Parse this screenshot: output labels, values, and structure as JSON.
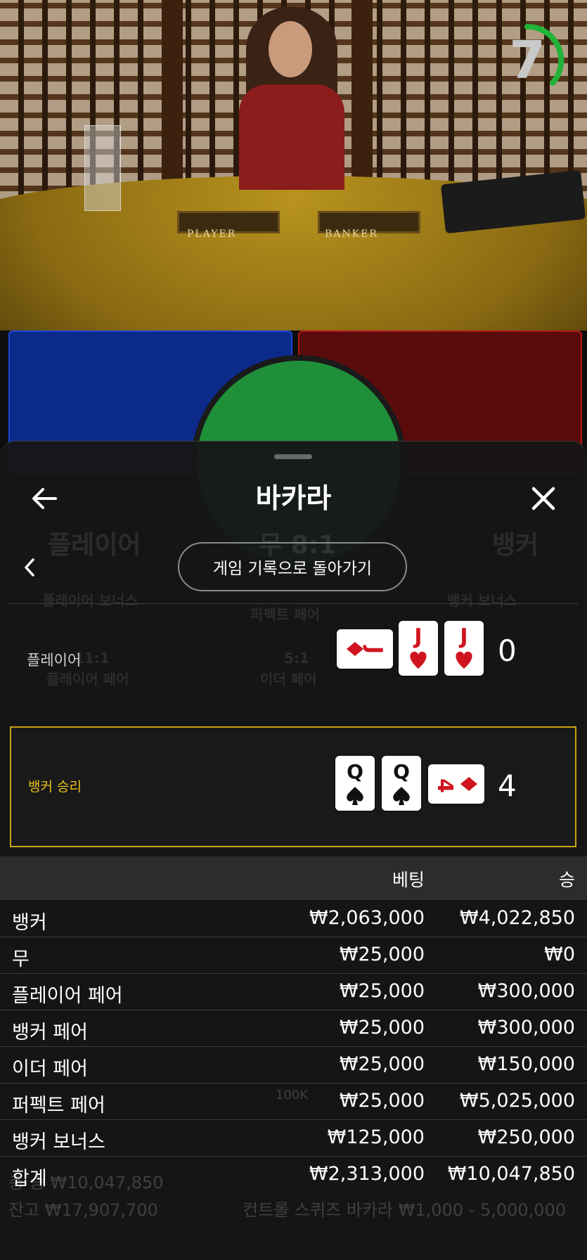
{
  "timer": {
    "seconds": "7"
  },
  "table_labels": {
    "player": "PLAYER",
    "banker": "BANKER"
  },
  "sheet": {
    "title": "바카라",
    "back_to_history": "게임 기록으로 돌아가기"
  },
  "hands": {
    "player": {
      "label": "플레이어",
      "score": "0",
      "cards": [
        {
          "rank": "J",
          "suit": "diamond",
          "color": "red",
          "orientation": "sideways"
        },
        {
          "rank": "J",
          "suit": "heart",
          "color": "red",
          "orientation": "upright"
        },
        {
          "rank": "J",
          "suit": "heart",
          "color": "red",
          "orientation": "upright"
        }
      ]
    },
    "banker": {
      "label": "뱅커 승리",
      "score": "4",
      "cards": [
        {
          "rank": "Q",
          "suit": "spade",
          "color": "black",
          "orientation": "upright"
        },
        {
          "rank": "Q",
          "suit": "spade",
          "color": "black",
          "orientation": "upright"
        },
        {
          "rank": "4",
          "suit": "diamond",
          "color": "red",
          "orientation": "sideways"
        }
      ]
    }
  },
  "results": {
    "headers": {
      "bet": "베팅",
      "win": "승"
    },
    "rows": [
      {
        "name": "뱅커",
        "bet": "₩2,063,000",
        "win": "₩4,022,850"
      },
      {
        "name": "무",
        "bet": "₩25,000",
        "win": "₩0"
      },
      {
        "name": "플레이어 페어",
        "bet": "₩25,000",
        "win": "₩300,000"
      },
      {
        "name": "뱅커 페어",
        "bet": "₩25,000",
        "win": "₩300,000"
      },
      {
        "name": "이더 페어",
        "bet": "₩25,000",
        "win": "₩150,000"
      },
      {
        "name": "퍼펙트 페어",
        "bet": "₩25,000",
        "win": "₩5,025,000"
      },
      {
        "name": "뱅커 보너스",
        "bet": "₩125,000",
        "win": "₩250,000"
      },
      {
        "name": "합계",
        "bet": "₩2,313,000",
        "win": "₩10,047,850"
      }
    ]
  },
  "background_game": {
    "player": "플레이어",
    "tie": "무 8:1",
    "banker": "뱅커",
    "player_bonus": "플레이어 보너스",
    "perfect_pair": "퍼펙트 페어",
    "banker_bonus": "뱅커 보너스",
    "player_pair": "플레이어 페어",
    "either_pair": "이더 페어",
    "odds_1": "11:1",
    "odds_5": "5:1",
    "total_win": "총 승 ₩10,047,850",
    "balance": "잔고 ₩17,907,700",
    "chip": "100K",
    "game_name": "컨트롤 스퀴즈 바카라 ₩1,000 - 5,000,000"
  },
  "colors": {
    "accent_gold": "#c9a313",
    "card_red": "#d0141f",
    "timer_green": "#22b33a",
    "player_blue": "#1b46d6",
    "banker_red": "#b01818"
  }
}
